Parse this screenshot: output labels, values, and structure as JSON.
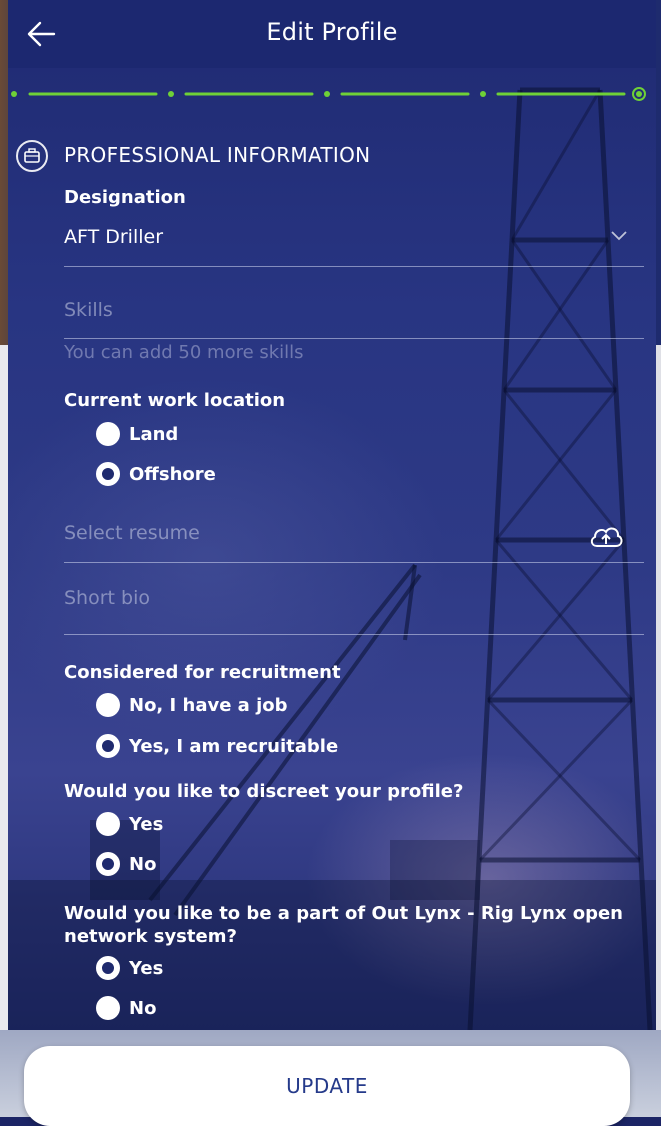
{
  "header": {
    "title": "Edit Profile"
  },
  "stepper": {
    "total_steps": 5,
    "current_step": 5
  },
  "section": {
    "title": "PROFESSIONAL INFORMATION",
    "icon": "briefcase-icon"
  },
  "designation": {
    "label": "Designation",
    "value": "AFT Driller"
  },
  "skills": {
    "placeholder": "Skills",
    "hint": "You can add 50 more skills"
  },
  "work_location": {
    "label": "Current work location",
    "options": [
      {
        "label": "Land",
        "selected": false
      },
      {
        "label": "Offshore",
        "selected": true
      }
    ]
  },
  "resume": {
    "placeholder": "Select resume",
    "icon": "upload-cloud-icon"
  },
  "bio": {
    "placeholder": "Short bio"
  },
  "recruitment": {
    "label": "Considered for recruitment",
    "options": [
      {
        "label": "No, I have a job",
        "selected": false
      },
      {
        "label": "Yes, I am recruitable",
        "selected": true
      }
    ]
  },
  "discreet": {
    "label": "Would you like to discreet your profile?",
    "options": [
      {
        "label": "Yes",
        "selected": false
      },
      {
        "label": "No",
        "selected": true
      }
    ]
  },
  "network": {
    "label": "Would you like to be a part of Out Lynx - Rig Lynx open network system?",
    "options": [
      {
        "label": "Yes",
        "selected": true
      },
      {
        "label": "No",
        "selected": false
      }
    ]
  },
  "actions": {
    "update_label": "UPDATE"
  },
  "colors": {
    "header": "#1c2870",
    "stepper_green": "#6fd137",
    "button_text": "#253a8a"
  }
}
